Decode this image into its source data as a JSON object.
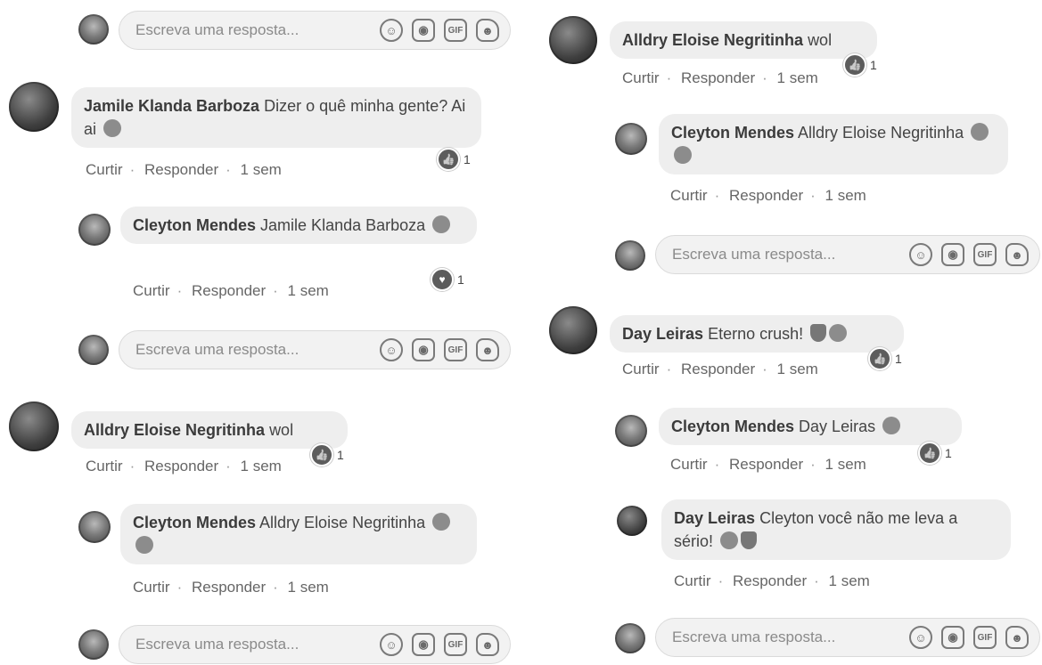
{
  "reply_placeholder": "Escreva uma resposta...",
  "actions": {
    "like": "Curtir",
    "reply": "Responder",
    "time": "1 sem"
  },
  "comments": {
    "jamile": {
      "author": "Jamile Klanda Barboza",
      "text": "Dizer o quê minha gente? Ai ai",
      "reactions": "1"
    },
    "cleyton_jamile": {
      "author": "Cleyton Mendes",
      "text": "Jamile Klanda Barboza",
      "reactions": "1"
    },
    "alldry_left": {
      "author": "Alldry Eloise Negritinha",
      "text": "wol",
      "reactions": "1"
    },
    "cleyton_alldry_left": {
      "author": "Cleyton Mendes",
      "text": "Alldry Eloise Negritinha"
    },
    "alldry_right": {
      "author": "Alldry Eloise Negritinha",
      "text": "wol",
      "reactions": "1"
    },
    "cleyton_alldry_right": {
      "author": "Cleyton Mendes",
      "text": "Alldry Eloise Negritinha"
    },
    "day": {
      "author": "Day Leiras",
      "text": "Eterno crush!",
      "reactions": "1"
    },
    "cleyton_day": {
      "author": "Cleyton Mendes",
      "text": "Day Leiras",
      "reactions": "1"
    },
    "day_reply": {
      "author": "Day Leiras",
      "text": "Cleyton você não me leva a sério!"
    }
  },
  "icons": [
    "emoji-icon",
    "camera-icon",
    "gif-icon",
    "sticker-icon"
  ]
}
